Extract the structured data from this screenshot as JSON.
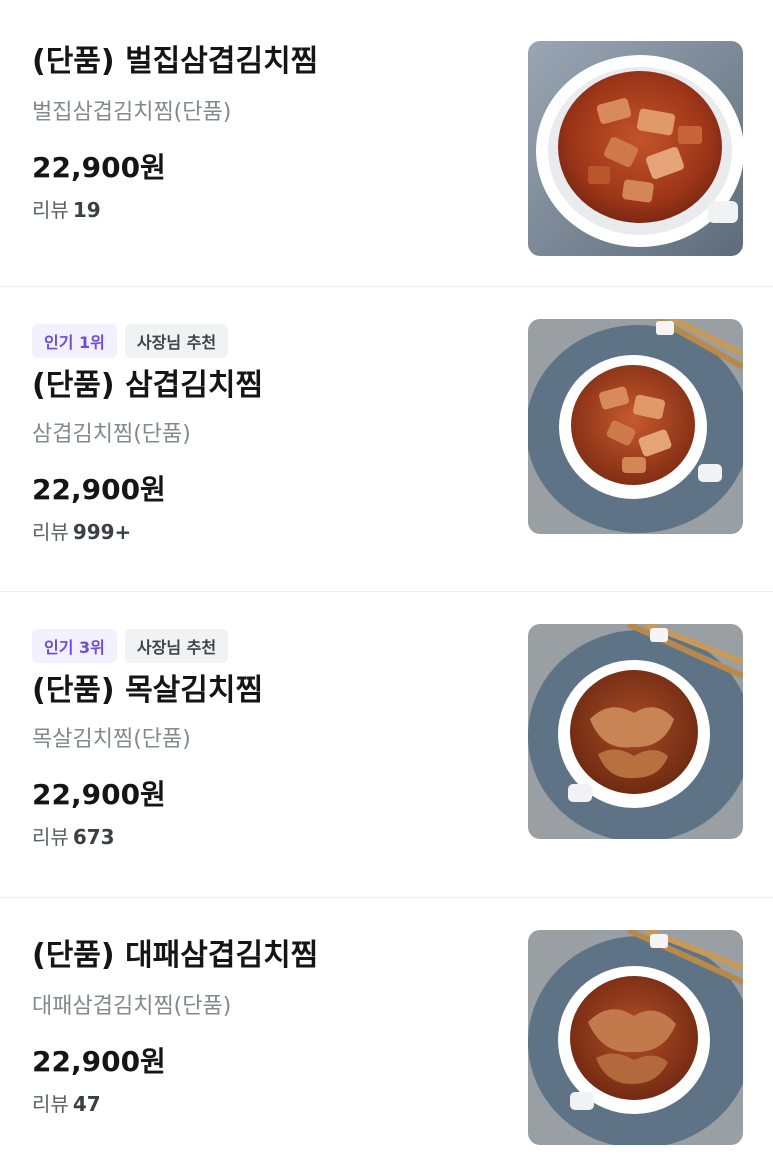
{
  "items": [
    {
      "name": "(단품) 벌집삼겹김치찜",
      "description": "벌집삼겹김치찜(단품)",
      "price": "22,900원",
      "review_label": "리뷰",
      "review_count": "19",
      "badges": [],
      "image": "dish-photo"
    },
    {
      "name": "(단품) 삼겹김치찜",
      "description": "삼겹김치찜(단품)",
      "price": "22,900원",
      "review_label": "리뷰",
      "review_count": "999+",
      "badges": [
        "인기 1위",
        "사장님 추천"
      ],
      "image": "dish-photo"
    },
    {
      "name": "(단품) 목살김치찜",
      "description": "목살김치찜(단품)",
      "price": "22,900원",
      "review_label": "리뷰",
      "review_count": "673",
      "badges": [
        "인기 3위",
        "사장님 추천"
      ],
      "image": "dish-photo"
    },
    {
      "name": "(단품) 대패삼겹김치찜",
      "description": "대패삼겹김치찜(단품)",
      "price": "22,900원",
      "review_label": "리뷰",
      "review_count": "47",
      "badges": [],
      "image": "dish-photo"
    }
  ],
  "colors": {
    "badge_rank_bg": "#f3f0ff",
    "badge_rank_text": "#6a4fd8",
    "badge_owner_bg": "#f1f2f4",
    "badge_owner_text": "#3f4349",
    "price": "#151515",
    "description": "#85888d"
  }
}
